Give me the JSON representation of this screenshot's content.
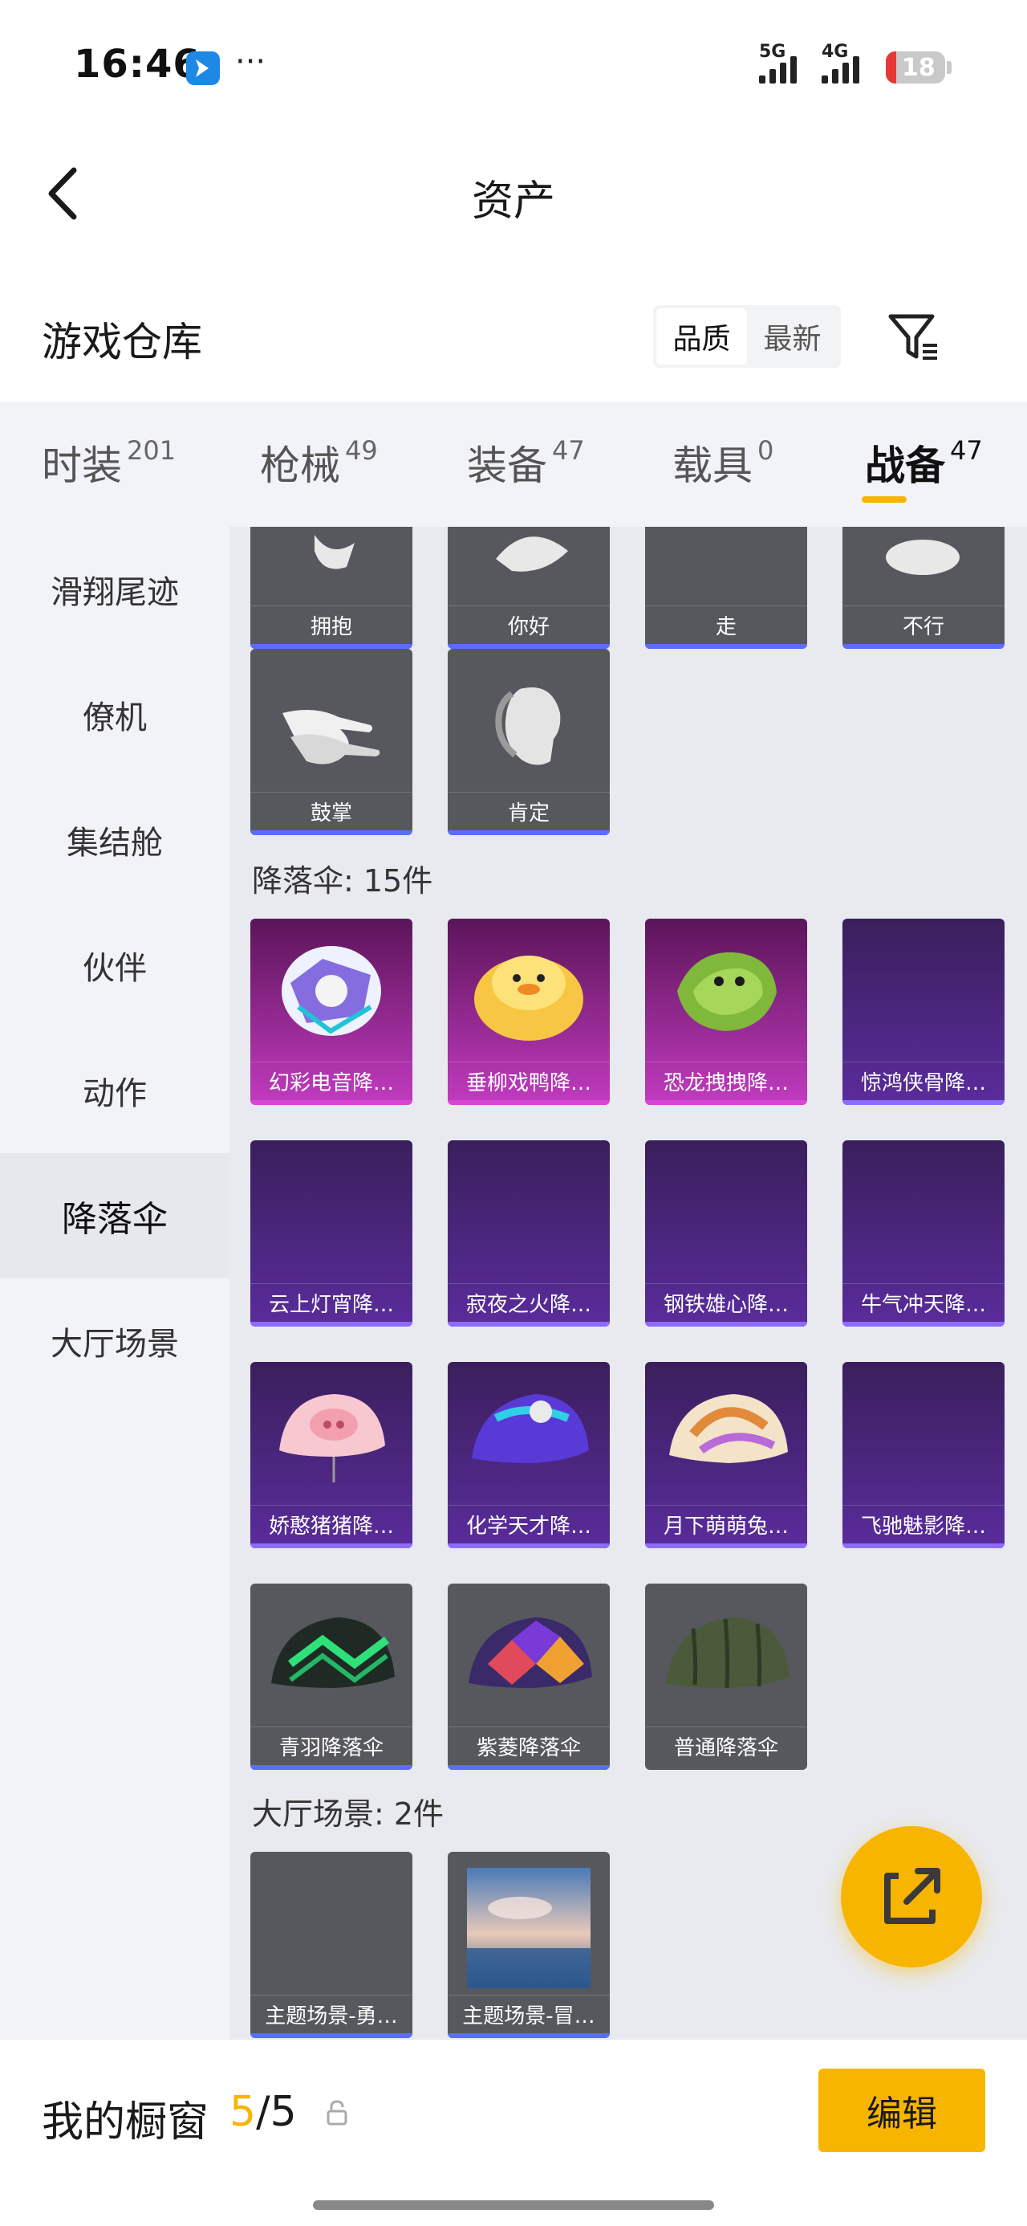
{
  "status_bar": {
    "time": "16:46",
    "more": "···",
    "net1": "5G",
    "net2": "4G",
    "battery": "18"
  },
  "nav": {
    "title": "资产"
  },
  "header": {
    "title": "游戏仓库",
    "sort_options": [
      "品质",
      "最新"
    ],
    "sort_selected": "品质"
  },
  "tabs": [
    {
      "label": "时装",
      "count": "201"
    },
    {
      "label": "枪械",
      "count": "49"
    },
    {
      "label": "装备",
      "count": "47"
    },
    {
      "label": "载具",
      "count": "0"
    },
    {
      "label": "战备",
      "count": "47",
      "active": true
    }
  ],
  "sidebar": [
    {
      "label": "滑翔尾迹"
    },
    {
      "label": "僚机"
    },
    {
      "label": "集结舱"
    },
    {
      "label": "伙伴"
    },
    {
      "label": "动作"
    },
    {
      "label": "降落伞",
      "active": true
    },
    {
      "label": "大厅场景"
    }
  ],
  "actions_row1": [
    "拥抱",
    "你好",
    "走",
    "不行"
  ],
  "actions_row2": [
    "鼓掌",
    "肯定"
  ],
  "parachute_group": {
    "title": "降落伞: 15件"
  },
  "parachutes": [
    "幻彩电音降…",
    "垂柳戏鸭降…",
    "恐龙拽拽降…",
    "惊鸿侠骨降…",
    "云上灯宵降…",
    "寂夜之火降…",
    "钢铁雄心降…",
    "牛气冲天降…",
    "娇憨猪猪降…",
    "化学天才降…",
    "月下萌萌兔…",
    "飞驰魅影降…",
    "青羽降落伞",
    "紫菱降落伞",
    "普通降落伞"
  ],
  "lobby_group": {
    "title": "大厅场景: 2件"
  },
  "lobby_scenes": [
    "主题场景-勇…",
    "主题场景-冒…"
  ],
  "showcase": {
    "label": "我的橱窗",
    "used": "5",
    "separator": "/",
    "total": "5",
    "edit_label": "编辑"
  },
  "colors": {
    "accent": "#f7b500",
    "rarity_purple": "#5a2c9c",
    "rarity_pink": "#c23bc0",
    "rarity_blue_bar": "#5b6cff"
  }
}
